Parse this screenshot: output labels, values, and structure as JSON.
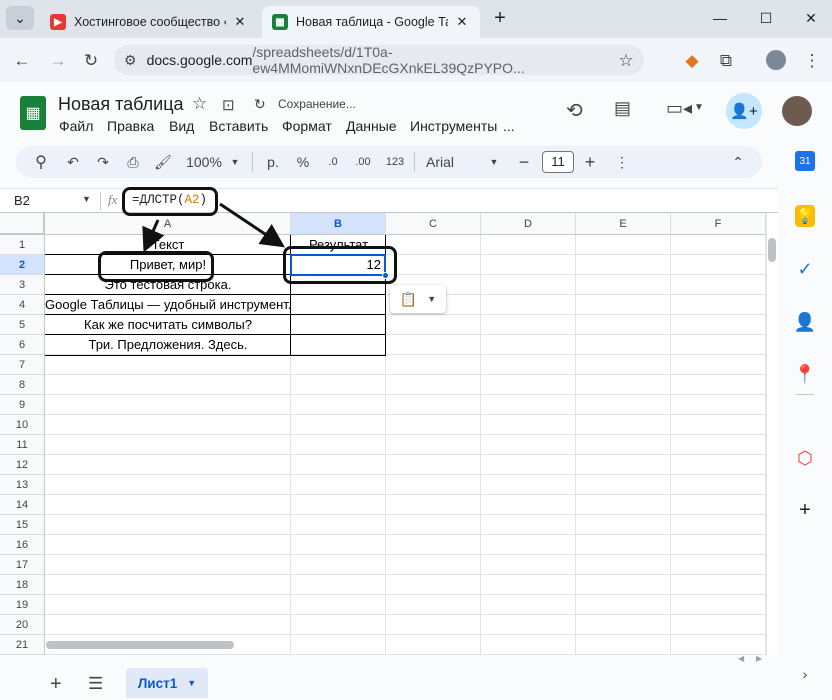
{
  "browser": {
    "tabs": [
      {
        "title": "Хостинговое сообщество «Tim",
        "active": false,
        "favicon": "youtube-red-icon"
      },
      {
        "title": "Новая таблица - Google Табли",
        "active": true,
        "favicon": "sheets-green-icon"
      }
    ],
    "new_tab_label": "+",
    "url_domain": "docs.google.com",
    "url_path": "/spreadsheets/d/1T0a-ew4MMomiWNxnDEcGXnkEL39QzPYPO..."
  },
  "doc": {
    "title": "Новая таблица",
    "status": "Сохранение...",
    "menu": [
      "Файл",
      "Правка",
      "Вид",
      "Вставить",
      "Формат",
      "Данные",
      "Инструменты",
      "..."
    ]
  },
  "toolbar": {
    "zoom": "100%",
    "currency": "р.",
    "percent": "%",
    "dec_decrease": ".0",
    "dec_increase": ".00",
    "number_format": "123",
    "font": "Arial",
    "font_size": "11"
  },
  "formula_bar": {
    "cell_ref": "B2",
    "fx": "fx",
    "formula_prefix": "=ДЛСТР(",
    "formula_arg": "A2",
    "formula_suffix": ")"
  },
  "grid": {
    "columns": [
      "A",
      "B",
      "C",
      "D",
      "E",
      "F"
    ],
    "rows": [
      "1",
      "2",
      "3",
      "4",
      "5",
      "6",
      "7",
      "8",
      "9",
      "10",
      "11",
      "12",
      "13",
      "14",
      "15",
      "16",
      "17",
      "18",
      "19",
      "20",
      "21"
    ],
    "cells": {
      "a1": "Текст",
      "b1": "Результат",
      "a2": "Привет, мир!",
      "b2": "12",
      "a3": "Это тестовая строка.",
      "a4": "Google Таблицы — удобный инструмент.",
      "a5": "Как же посчитать символы?",
      "a6": "Три. Предложения. Здесь."
    }
  },
  "sheets": {
    "add_label": "+",
    "active_sheet": "Лист1"
  },
  "colors": {
    "accent": "#0b57d0",
    "sheets_green": "#188038",
    "formula_ref": "#e37400",
    "share_button_bg": "#c2e7ff"
  }
}
